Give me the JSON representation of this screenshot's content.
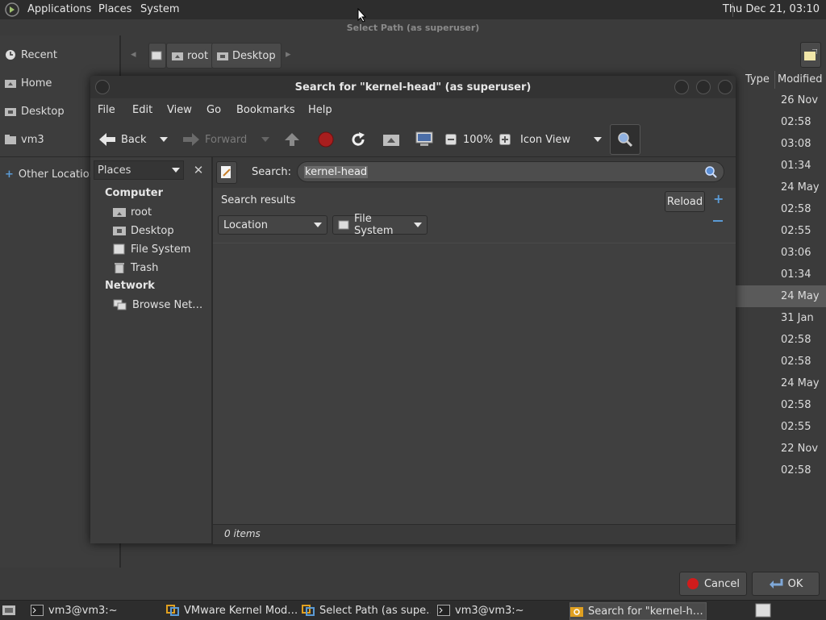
{
  "top_panel": {
    "menus": [
      "Applications",
      "Places",
      "System"
    ],
    "clock": "Thu Dec 21, 03:10"
  },
  "bg_dialog": {
    "title": "Select Path (as superuser)",
    "sidebar": [
      "Recent",
      "Home",
      "Desktop",
      "vm3",
      "Other Locations"
    ],
    "breadcrumbs": [
      "root",
      "Desktop"
    ],
    "columns": {
      "type": "Type",
      "modified": "Modified"
    },
    "modified": [
      "26 Nov",
      "02:58",
      "03:08",
      "01:34",
      "24 May",
      "02:58",
      "02:55",
      "03:06",
      "01:34",
      "24 May",
      "31 Jan",
      "02:58",
      "02:58",
      "24 May",
      "02:58",
      "02:55",
      "22 Nov",
      "02:58"
    ],
    "selected_index": 9,
    "cancel": "Cancel",
    "ok": "OK"
  },
  "window": {
    "title": "Search for \"kernel-head\" (as superuser)",
    "menu": [
      "File",
      "Edit",
      "View",
      "Go",
      "Bookmarks",
      "Help"
    ],
    "toolbar": {
      "back": "Back",
      "forward": "Forward",
      "zoom": "100%",
      "view_mode": "Icon View"
    },
    "sidebar": {
      "selector": "Places",
      "computer_header": "Computer",
      "computer_items": [
        "root",
        "Desktop",
        "File System",
        "Trash"
      ],
      "network_header": "Network",
      "network_items": [
        "Browse Net…"
      ]
    },
    "search": {
      "label": "Search:",
      "value": "kernel-head"
    },
    "results": {
      "title": "Search results",
      "reload": "Reload",
      "criterion": "Location",
      "location_value": "File System"
    },
    "status": "0 items"
  },
  "taskbar": {
    "tasks": [
      "vm3@vm3:~",
      "VMware Kernel Mod…",
      "Select Path (as supe…",
      "vm3@vm3:~",
      "Search for \"kernel-h…"
    ]
  }
}
